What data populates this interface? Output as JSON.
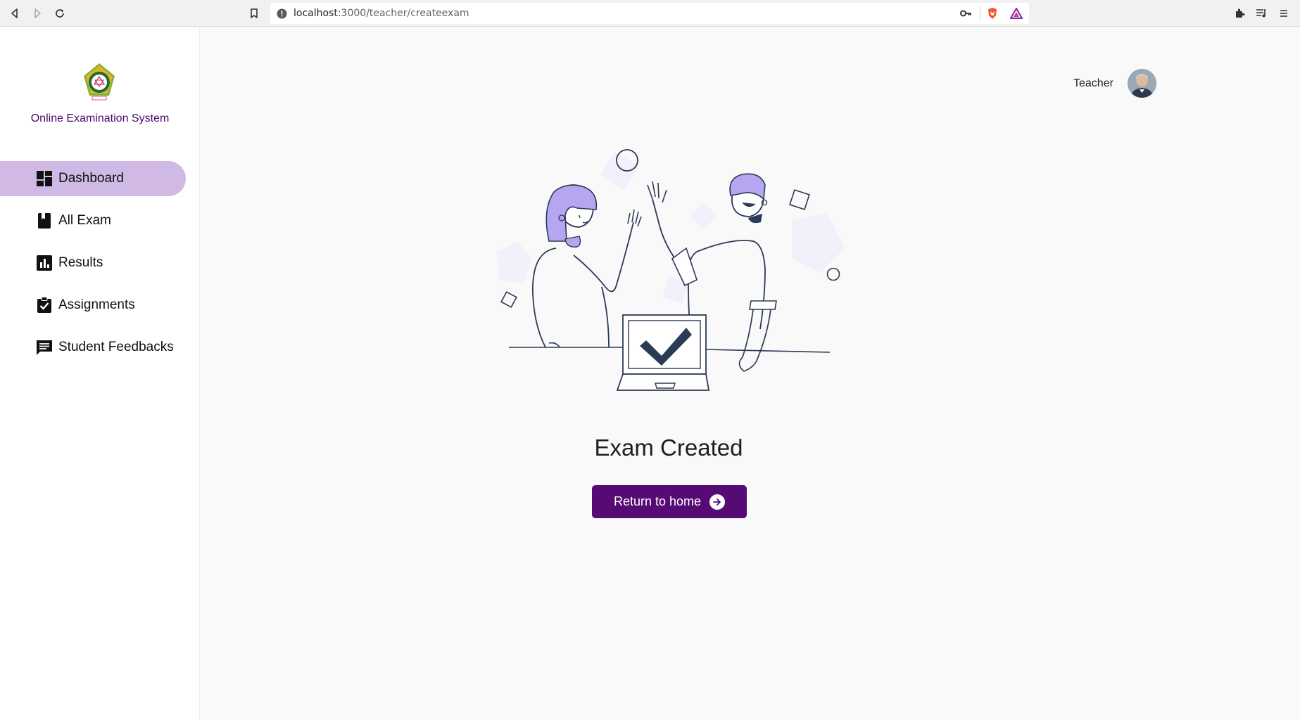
{
  "browser": {
    "url_host": "localhost",
    "url_path": ":3000/teacher/createexam"
  },
  "sidebar": {
    "app_title": "Online Examination System",
    "items": [
      {
        "label": "Dashboard",
        "icon": "dashboard-icon",
        "active": true
      },
      {
        "label": "All Exam",
        "icon": "book-icon",
        "active": false
      },
      {
        "label": "Results",
        "icon": "bar-chart-icon",
        "active": false
      },
      {
        "label": "Assignments",
        "icon": "clipboard-check-icon",
        "active": false
      },
      {
        "label": "Student Feedbacks",
        "icon": "feedback-icon",
        "active": false
      }
    ]
  },
  "header": {
    "user_role": "Teacher"
  },
  "main": {
    "headline": "Exam Created",
    "button_label": "Return to home"
  },
  "colors": {
    "accent": "#560a73",
    "active_menu": "#d1b9e6",
    "title_color": "#4a0a6b",
    "illustration_purple": "#b6a6f2"
  }
}
